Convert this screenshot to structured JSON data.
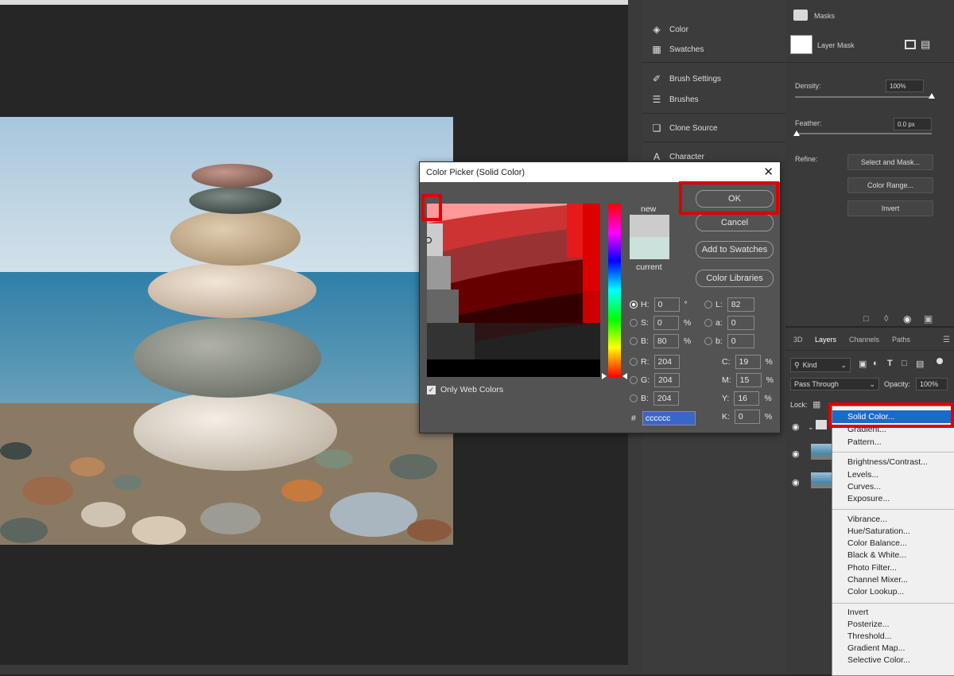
{
  "right_panel_items": [
    {
      "icon": "palette-icon",
      "label": "Color"
    },
    {
      "icon": "swatches-icon",
      "label": "Swatches"
    },
    {
      "icon": "brush-settings-icon",
      "label": "Brush Settings"
    },
    {
      "icon": "brushes-icon",
      "label": "Brushes"
    },
    {
      "icon": "clone-source-icon",
      "label": "Clone Source"
    },
    {
      "icon": "character-icon",
      "label": "Character"
    }
  ],
  "properties": {
    "title": "Masks",
    "layer_mask_label": "Layer Mask",
    "density_label": "Density:",
    "density_value": "100%",
    "feather_label": "Feather:",
    "feather_value": "0.0 px",
    "refine_label": "Refine:",
    "select_and_mask": "Select and Mask...",
    "color_range": "Color Range...",
    "invert": "Invert"
  },
  "layers_panel": {
    "tabs": [
      "3D",
      "Layers",
      "Channels",
      "Paths"
    ],
    "active_tab": "Layers",
    "kind_label": "Kind",
    "blend_mode": "Pass Through",
    "opacity_label": "Opacity:",
    "opacity_value": "100%",
    "lock_label": "Lock:"
  },
  "adjustment_menu": {
    "groups": [
      [
        "Solid Color...",
        "Gradient...",
        "Pattern..."
      ],
      [
        "Brightness/Contrast...",
        "Levels...",
        "Curves...",
        "Exposure..."
      ],
      [
        "Vibrance...",
        "Hue/Saturation...",
        "Color Balance...",
        "Black & White...",
        "Photo Filter...",
        "Channel Mixer...",
        "Color Lookup..."
      ],
      [
        "Invert",
        "Posterize...",
        "Threshold...",
        "Gradient Map...",
        "Selective Color..."
      ]
    ],
    "highlighted": "Solid Color..."
  },
  "color_picker": {
    "title": "Color Picker (Solid Color)",
    "ok": "OK",
    "cancel": "Cancel",
    "add_to_swatches": "Add to Swatches",
    "color_libraries": "Color Libraries",
    "new_label": "new",
    "current_label": "current",
    "new_color": "#cccccc",
    "current_color": "#cce0dc",
    "only_web_colors": "Only Web Colors",
    "only_web_colors_checked": true,
    "fields": {
      "H": {
        "label": "H:",
        "value": "0",
        "unit": "°"
      },
      "S": {
        "label": "S:",
        "value": "0",
        "unit": "%"
      },
      "Bv": {
        "label": "B:",
        "value": "80",
        "unit": "%"
      },
      "R": {
        "label": "R:",
        "value": "204"
      },
      "G": {
        "label": "G:",
        "value": "204"
      },
      "Bb": {
        "label": "B:",
        "value": "204"
      },
      "L": {
        "label": "L:",
        "value": "82"
      },
      "a": {
        "label": "a:",
        "value": "0"
      },
      "b": {
        "label": "b:",
        "value": "0"
      },
      "C": {
        "label": "C:",
        "value": "19",
        "unit": "%"
      },
      "M": {
        "label": "M:",
        "value": "15",
        "unit": "%"
      },
      "Y": {
        "label": "Y:",
        "value": "16",
        "unit": "%"
      },
      "K": {
        "label": "K:",
        "value": "0",
        "unit": "%"
      }
    },
    "hex_label": "#",
    "hex_value": "cccccc"
  },
  "colors": {
    "highlight_red": "#e00000",
    "menu_highlight": "#1b6ac9"
  }
}
